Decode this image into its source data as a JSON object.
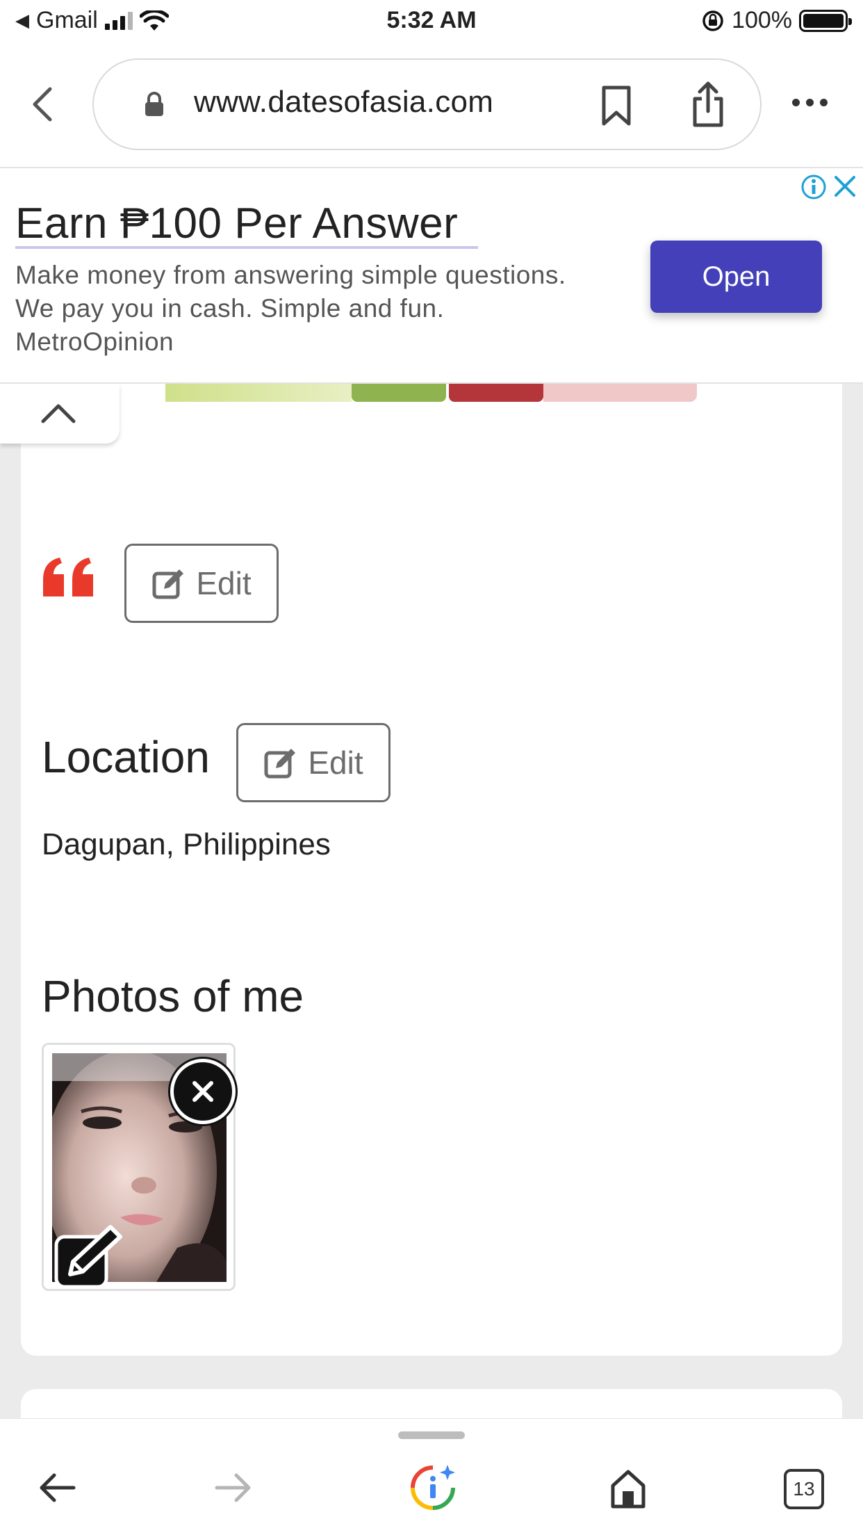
{
  "status_bar": {
    "back_app": "Gmail",
    "time": "5:32 AM",
    "battery": "100%"
  },
  "address_bar": {
    "url": "www.datesofasia.com"
  },
  "ad": {
    "headline": "Earn ₱100 Per Answer",
    "body_line1": "Make money from answering simple questions.",
    "body_line2": "We pay you in cash. Simple and fun.",
    "advertiser": "MetroOpinion",
    "cta": "Open",
    "accent_color": "#4340b9"
  },
  "profile": {
    "quote_edit_label": "Edit",
    "location_heading": "Location",
    "location_edit_label": "Edit",
    "location_value": "Dagupan, Philippines",
    "photos_heading": "Photos of me",
    "quote_color": "#e8392a"
  },
  "toolbar": {
    "tab_count": "13"
  }
}
